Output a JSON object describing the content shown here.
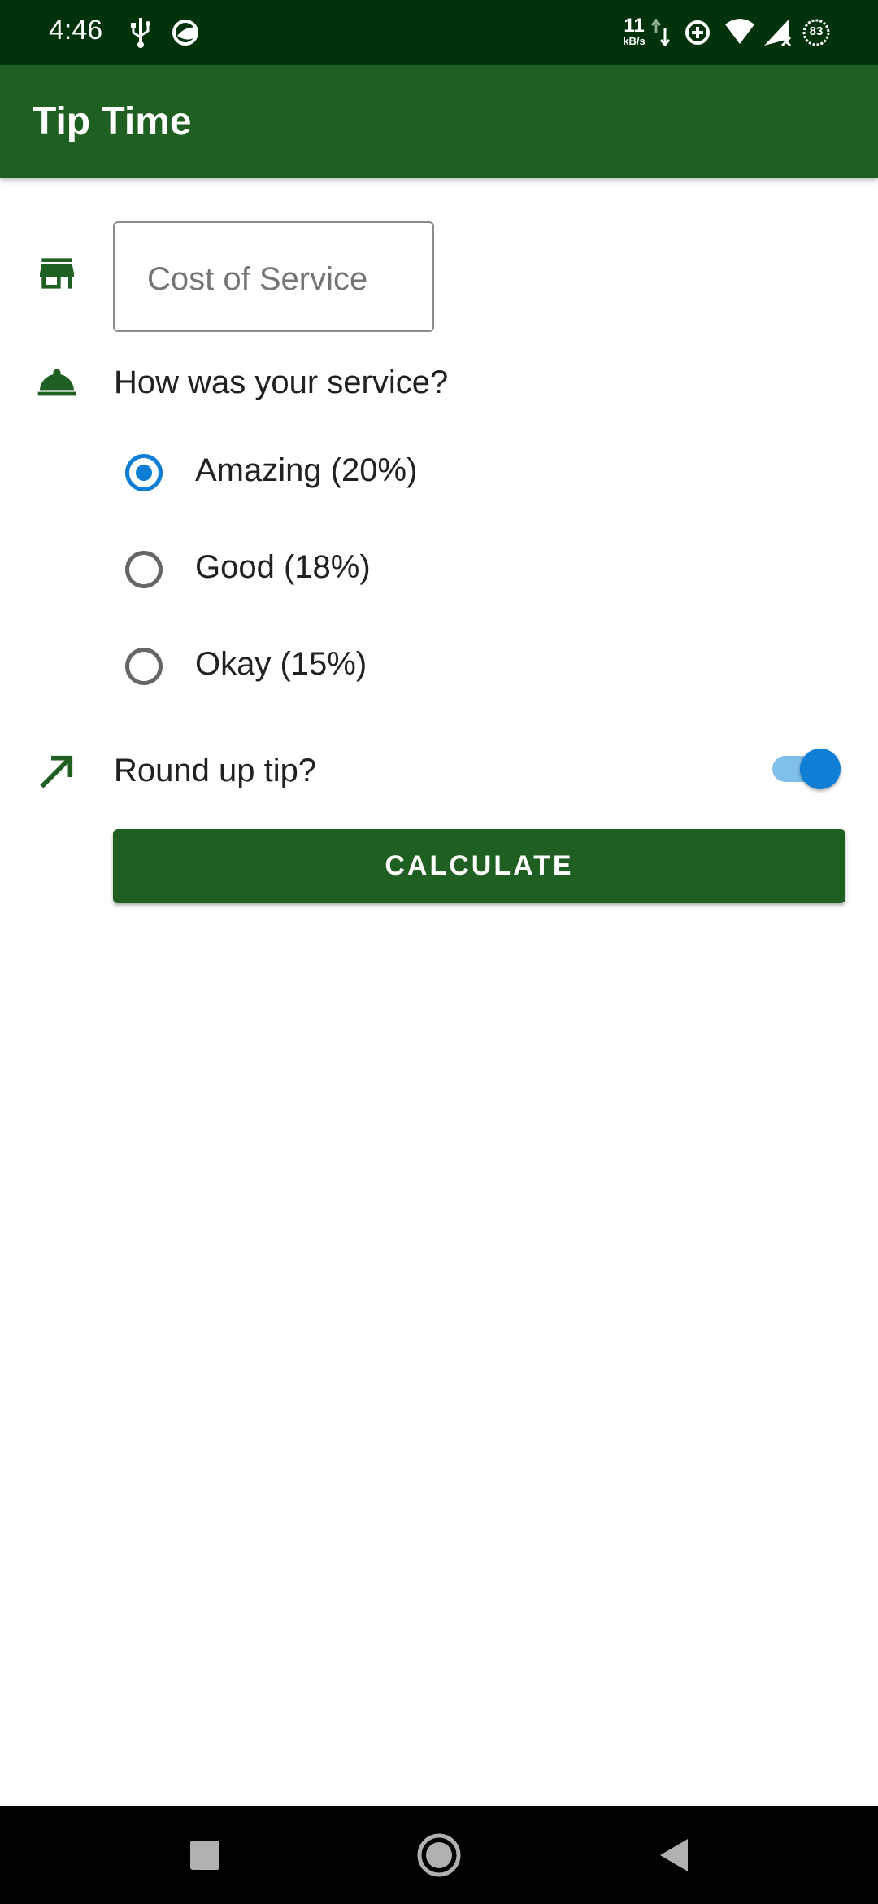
{
  "status_bar": {
    "time": "4:46",
    "net_speed_value": "11",
    "net_speed_unit": "kB/s",
    "battery_level": "83",
    "icons": [
      "usb-icon",
      "data-saver-icon",
      "network-activity-icon",
      "data-saver-plus-icon",
      "wifi-icon",
      "signal-icon",
      "battery-icon"
    ]
  },
  "app_bar": {
    "title": "Tip Time"
  },
  "cost_field": {
    "placeholder": "Cost of Service",
    "value": "",
    "icon": "store-icon"
  },
  "service_question": {
    "label": "How was your service?",
    "icon": "room-service-icon"
  },
  "tip_options": [
    {
      "label": "Amazing (20%)",
      "selected": true
    },
    {
      "label": "Good (18%)",
      "selected": false
    },
    {
      "label": "Okay (15%)",
      "selected": false
    }
  ],
  "round_up": {
    "label": "Round up tip?",
    "enabled": true,
    "icon": "trending-up-icon"
  },
  "calculate_button": {
    "label": "CALCULATE"
  },
  "nav_bar": {
    "buttons": [
      "recents-button",
      "home-button",
      "back-button"
    ]
  },
  "colors": {
    "status_bar": "#00330a",
    "primary": "#1f5f22",
    "accent": "#0f7fd6"
  }
}
